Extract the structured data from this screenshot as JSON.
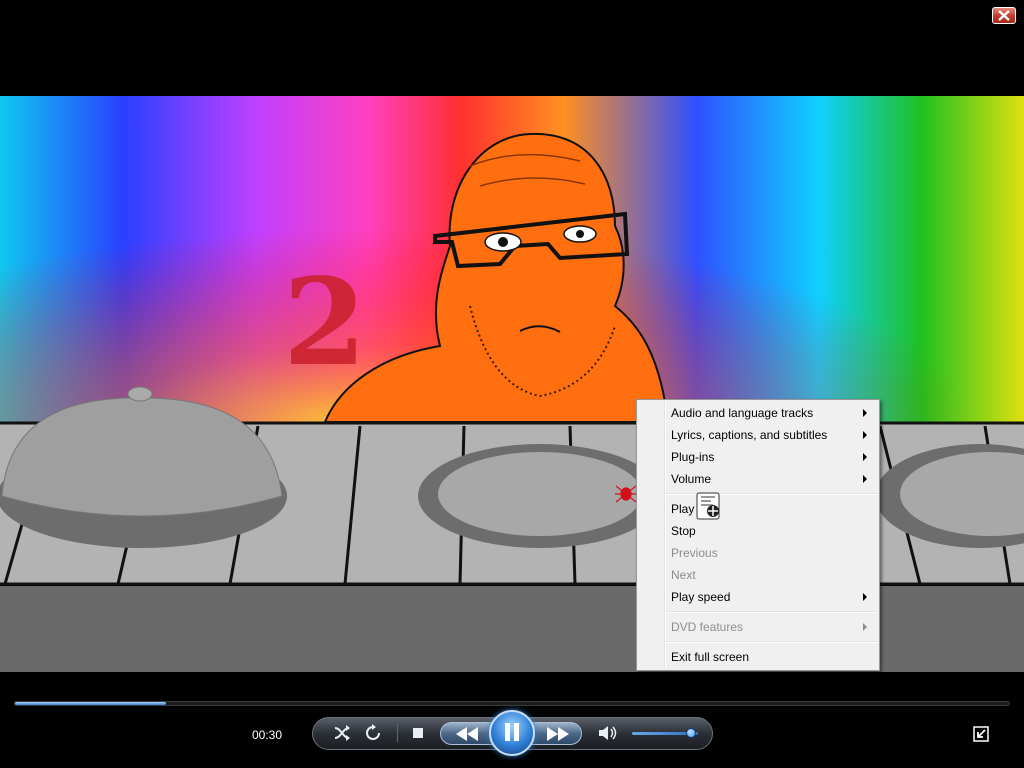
{
  "window": {
    "close_icon": "close-icon"
  },
  "video": {
    "overlay_number": "2"
  },
  "context_menu": {
    "items": [
      {
        "label": "Audio and language tracks",
        "submenu": true,
        "disabled": false
      },
      {
        "label": "Lyrics, captions, and subtitles",
        "submenu": true,
        "disabled": false
      },
      {
        "label": "Plug-ins",
        "submenu": true,
        "disabled": false
      },
      {
        "label": "Volume",
        "submenu": true,
        "disabled": false
      },
      {
        "label": "Play",
        "submenu": false,
        "disabled": false
      },
      {
        "label": "Stop",
        "submenu": false,
        "disabled": false
      },
      {
        "label": "Previous",
        "submenu": false,
        "disabled": true
      },
      {
        "label": "Next",
        "submenu": false,
        "disabled": true
      },
      {
        "label": "Play speed",
        "submenu": true,
        "disabled": false
      },
      {
        "label": "DVD features",
        "submenu": true,
        "disabled": true
      },
      {
        "label": "Exit full screen",
        "submenu": false,
        "disabled": false
      }
    ]
  },
  "player": {
    "elapsed_time": "00:30",
    "seek_progress": 0.152,
    "volume_level": 0.9,
    "accent_color": "#2f7fd6"
  }
}
